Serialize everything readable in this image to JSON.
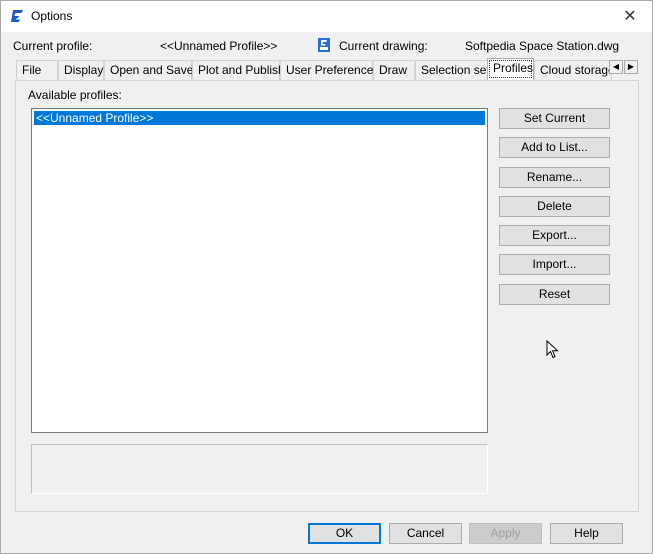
{
  "window": {
    "title": "Options"
  },
  "header": {
    "current_profile_label": "Current profile:",
    "current_profile_value": "<<Unnamed Profile>>",
    "current_drawing_label": "Current drawing:",
    "current_drawing_value": "Softpedia Space Station.dwg"
  },
  "tabs": [
    {
      "label": "File"
    },
    {
      "label": "Display"
    },
    {
      "label": "Open and Save"
    },
    {
      "label": "Plot and Publish"
    },
    {
      "label": "User Preferences"
    },
    {
      "label": "Draw"
    },
    {
      "label": "Selection set"
    },
    {
      "label": "Profiles",
      "active": true
    },
    {
      "label": "Cloud storage"
    }
  ],
  "profiles_panel": {
    "available_label": "Available profiles:",
    "profiles": [
      "<<Unnamed Profile>>"
    ],
    "selected": "<<Unnamed Profile>>",
    "buttons": {
      "set_current": "Set Current",
      "add_to_list": "Add to List...",
      "rename": "Rename...",
      "delete": "Delete",
      "export": "Export...",
      "import": "Import...",
      "reset": "Reset"
    }
  },
  "footer": {
    "ok": "OK",
    "cancel": "Cancel",
    "apply": "Apply",
    "help": "Help"
  },
  "colors": {
    "selection": "#0078d7",
    "brand": "#1a5bc4"
  }
}
